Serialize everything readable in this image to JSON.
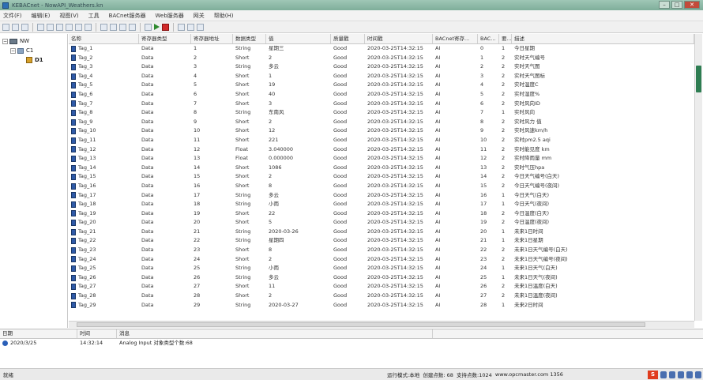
{
  "window": {
    "title": "KEBACnet - NowAPI_Weathers.kn"
  },
  "menu": [
    "文件(F)",
    "编辑(E)",
    "视图(V)",
    "工具",
    "BACnet服务器",
    "Web服务器",
    "网关",
    "帮助(H)"
  ],
  "tree": {
    "root": "NW",
    "channel": "C1",
    "device": "D1"
  },
  "columns": [
    "名称",
    "寄存器类型",
    "寄存器地址",
    "数据类型",
    "值",
    "质量戳",
    "时间戳",
    "BACnet寄存...",
    "BAC...",
    "要...",
    "描述"
  ],
  "rows": [
    [
      "Tag_1",
      "Data",
      "1",
      "String",
      "星期三",
      "Good",
      "2020-03-25T14:32:15",
      "AI",
      "0",
      "1",
      "今日星期"
    ],
    [
      "Tag_2",
      "Data",
      "2",
      "Short",
      "2",
      "Good",
      "2020-03-25T14:32:15",
      "AI",
      "1",
      "2",
      "实时天气编号"
    ],
    [
      "Tag_3",
      "Data",
      "3",
      "String",
      "多云",
      "Good",
      "2020-03-25T14:32:15",
      "AI",
      "2",
      "2",
      "实时天气图"
    ],
    [
      "Tag_4",
      "Data",
      "4",
      "Short",
      "1",
      "Good",
      "2020-03-25T14:32:15",
      "AI",
      "3",
      "2",
      "实时天气图标"
    ],
    [
      "Tag_5",
      "Data",
      "5",
      "Short",
      "19",
      "Good",
      "2020-03-25T14:32:15",
      "AI",
      "4",
      "2",
      "实时温度C"
    ],
    [
      "Tag_6",
      "Data",
      "6",
      "Short",
      "40",
      "Good",
      "2020-03-25T14:32:15",
      "AI",
      "5",
      "2",
      "实时湿度%"
    ],
    [
      "Tag_7",
      "Data",
      "7",
      "Short",
      "3",
      "Good",
      "2020-03-25T14:32:15",
      "AI",
      "6",
      "2",
      "实时风向ID"
    ],
    [
      "Tag_8",
      "Data",
      "8",
      "String",
      "东南风",
      "Good",
      "2020-03-25T14:32:15",
      "AI",
      "7",
      "1",
      "实时风向"
    ],
    [
      "Tag_9",
      "Data",
      "9",
      "Short",
      "2",
      "Good",
      "2020-03-25T14:32:15",
      "AI",
      "8",
      "2",
      "实时风力 值"
    ],
    [
      "Tag_10",
      "Data",
      "10",
      "Short",
      "12",
      "Good",
      "2020-03-25T14:32:15",
      "AI",
      "9",
      "2",
      "实时风速km/h"
    ],
    [
      "Tag_11",
      "Data",
      "11",
      "Short",
      "221",
      "Good",
      "2020-03-25T14:32:15",
      "AI",
      "10",
      "2",
      "实时pm2.5 aqi"
    ],
    [
      "Tag_12",
      "Data",
      "12",
      "Float",
      "3.040000",
      "Good",
      "2020-03-25T14:32:15",
      "AI",
      "11",
      "2",
      "实时能见度 km"
    ],
    [
      "Tag_13",
      "Data",
      "13",
      "Float",
      "0.000000",
      "Good",
      "2020-03-25T14:32:15",
      "AI",
      "12",
      "2",
      "实时降雨量 mm"
    ],
    [
      "Tag_14",
      "Data",
      "14",
      "Short",
      "1086",
      "Good",
      "2020-03-25T14:32:15",
      "AI",
      "13",
      "2",
      "实时气压hpa"
    ],
    [
      "Tag_15",
      "Data",
      "15",
      "Short",
      "2",
      "Good",
      "2020-03-25T14:32:15",
      "AI",
      "14",
      "2",
      "今日天气编号(白天)"
    ],
    [
      "Tag_16",
      "Data",
      "16",
      "Short",
      "8",
      "Good",
      "2020-03-25T14:32:15",
      "AI",
      "15",
      "2",
      "今日天气编号(夜间)"
    ],
    [
      "Tag_17",
      "Data",
      "17",
      "String",
      "多云",
      "Good",
      "2020-03-25T14:32:15",
      "AI",
      "16",
      "1",
      "今日天气(白天)"
    ],
    [
      "Tag_18",
      "Data",
      "18",
      "String",
      "小雨",
      "Good",
      "2020-03-25T14:32:15",
      "AI",
      "17",
      "1",
      "今日天气(夜间)"
    ],
    [
      "Tag_19",
      "Data",
      "19",
      "Short",
      "22",
      "Good",
      "2020-03-25T14:32:15",
      "AI",
      "18",
      "2",
      "今日温度(白天)"
    ],
    [
      "Tag_20",
      "Data",
      "20",
      "Short",
      "5",
      "Good",
      "2020-03-25T14:32:15",
      "AI",
      "19",
      "2",
      "今日温度(夜间)"
    ],
    [
      "Tag_21",
      "Data",
      "21",
      "String",
      "2020-03-26",
      "Good",
      "2020-03-25T14:32:15",
      "AI",
      "20",
      "1",
      "未来1日时间"
    ],
    [
      "Tag_22",
      "Data",
      "22",
      "String",
      "星期四",
      "Good",
      "2020-03-25T14:32:15",
      "AI",
      "21",
      "1",
      "未来1日星期"
    ],
    [
      "Tag_23",
      "Data",
      "23",
      "Short",
      "8",
      "Good",
      "2020-03-25T14:32:15",
      "AI",
      "22",
      "2",
      "未来1日天气编号(白天)"
    ],
    [
      "Tag_24",
      "Data",
      "24",
      "Short",
      "2",
      "Good",
      "2020-03-25T14:32:15",
      "AI",
      "23",
      "2",
      "未来1日天气编号(夜间)"
    ],
    [
      "Tag_25",
      "Data",
      "25",
      "String",
      "小雨",
      "Good",
      "2020-03-25T14:32:15",
      "AI",
      "24",
      "1",
      "未来1日天气(白天)"
    ],
    [
      "Tag_26",
      "Data",
      "26",
      "String",
      "多云",
      "Good",
      "2020-03-25T14:32:15",
      "AI",
      "25",
      "1",
      "未来1日天气(夜间)"
    ],
    [
      "Tag_27",
      "Data",
      "27",
      "Short",
      "11",
      "Good",
      "2020-03-25T14:32:15",
      "AI",
      "26",
      "2",
      "未来1日温度(白天)"
    ],
    [
      "Tag_28",
      "Data",
      "28",
      "Short",
      "2",
      "Good",
      "2020-03-25T14:32:15",
      "AI",
      "27",
      "2",
      "未来1日温度(夜间)"
    ],
    [
      "Tag_29",
      "Data",
      "29",
      "String",
      "2020-03-27",
      "Good",
      "2020-03-25T14:32:15",
      "AI",
      "28",
      "1",
      "未来2日时间"
    ]
  ],
  "log": {
    "columns": [
      "日期",
      "时间",
      "消息"
    ],
    "rows": [
      [
        "2020/3/25",
        "14:32:14",
        "Analog Input 对象类型个数:68"
      ]
    ]
  },
  "status": {
    "ready": "就绪",
    "runtime": "运行模式:本地",
    "create_count": "创建点数: 68",
    "support_count": "支持点数:1024",
    "website": "www.opcmaster.com",
    "phone": "1356"
  },
  "colors": {
    "titlebar": "#8fb9a7",
    "scroll_thumb": "#2e7d52",
    "tag_icon": "#2f5aa8"
  }
}
